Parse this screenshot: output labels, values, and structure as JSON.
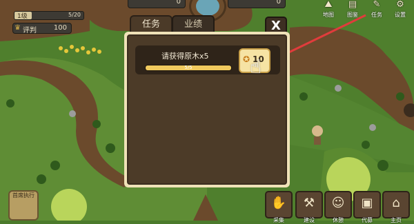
{
  "hud": {
    "level_label": "1级",
    "level_count": "5/20",
    "level_progress": 0.25,
    "rating_label": "评判",
    "rating_value": "100",
    "resource_1": "0",
    "resource_2": "0"
  },
  "right_icons": [
    {
      "label": "地图",
      "glyph": "⛰"
    },
    {
      "label": "图鉴",
      "glyph": "▤"
    },
    {
      "label": "任务",
      "glyph": "✎"
    },
    {
      "label": "设置",
      "glyph": "⚙"
    }
  ],
  "left_button": {
    "label": "首席执行"
  },
  "bottom_buttons": [
    {
      "label": "采集",
      "glyph": "✋"
    },
    {
      "label": "建设",
      "glyph": "⚒"
    },
    {
      "label": "休憩",
      "glyph": "☺"
    },
    {
      "label": "代募",
      "glyph": "▣"
    },
    {
      "label": "主页",
      "glyph": "⌂"
    }
  ],
  "panel": {
    "tab_active": "任务",
    "tab_inactive": "业绩",
    "close_label": "X",
    "task": {
      "title": "请获得原木x5",
      "progress_text": "5/5",
      "progress": 1.0,
      "reward_amount": "10",
      "reward_icon": "coin-icon"
    }
  },
  "colors": {
    "grass": "#4b7a2b",
    "path": "#6b4a2c",
    "panel_border": "#f0e2b8",
    "panel_bg": "#4c3b28",
    "progress": "#f0c95e",
    "arrow": "#e03c3c"
  }
}
